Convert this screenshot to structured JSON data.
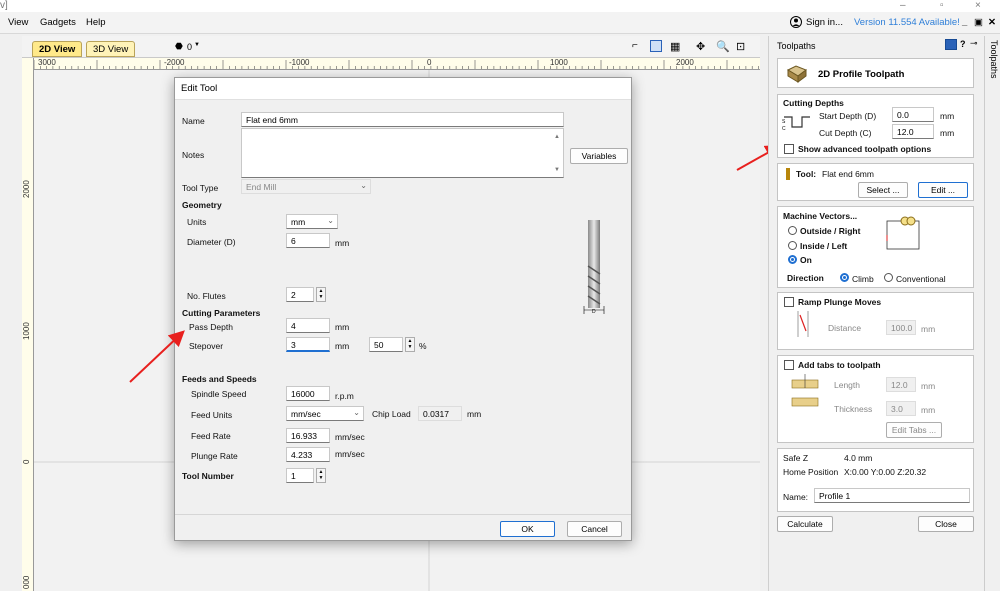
{
  "menubar": {
    "items": [
      "View",
      "Gadgets",
      "Help"
    ],
    "sign_in": "Sign in...",
    "version": "Version 11.554 Available!",
    "win_min": "–",
    "win_restore": "▫",
    "win_close": "×",
    "panel_min": "_",
    "panel_restore": "▣",
    "panel_close": "✕"
  },
  "view_tabs": {
    "tab_2d": "2D View",
    "tab_3d": "3D View",
    "layer_count": "0"
  },
  "ruler": {
    "top_labels": [
      "3000",
      "-2000",
      "-1000",
      "0",
      "1000",
      "2000"
    ],
    "left_labels": [
      "2000",
      "1000",
      "0",
      "000"
    ]
  },
  "dialog": {
    "title": "Edit Tool",
    "name_label": "Name",
    "name_value": "Flat end 6mm",
    "notes_label": "Notes",
    "notes_value": "",
    "variables_button": "Variables",
    "tool_type_label": "Tool Type",
    "tool_type_value": "End Mill",
    "geometry_heading": "Geometry",
    "units_label": "Units",
    "units_value": "mm",
    "diameter_label": "Diameter (D)",
    "diameter_value": "6",
    "diameter_unit": "mm",
    "flutes_label": "No. Flutes",
    "flutes_value": "2",
    "cutting_heading": "Cutting Parameters",
    "pass_depth_label": "Pass Depth",
    "pass_depth_value": "4",
    "pass_depth_unit": "mm",
    "stepover_label": "Stepover",
    "stepover_value": "3",
    "stepover_unit": "mm",
    "stepover_pct_value": "50",
    "stepover_pct_unit": "%",
    "feeds_heading": "Feeds and Speeds",
    "spindle_label": "Spindle Speed",
    "spindle_value": "16000",
    "spindle_unit": "r.p.m",
    "feed_units_label": "Feed Units",
    "feed_units_value": "mm/sec",
    "chip_load_label": "Chip Load",
    "chip_load_value": "0.0317",
    "chip_load_unit": "mm",
    "feed_rate_label": "Feed Rate",
    "feed_rate_value": "16.933",
    "feed_rate_unit": "mm/sec",
    "plunge_label": "Plunge Rate",
    "plunge_value": "4.233",
    "plunge_unit": "mm/sec",
    "tool_number_label": "Tool Number",
    "tool_number_value": "1",
    "ok_button": "OK",
    "cancel_button": "Cancel"
  },
  "panel": {
    "header": "Toolpaths",
    "side_tab": "Toolpaths",
    "title": "2D Profile Toolpath",
    "cutting_depths_heading": "Cutting Depths",
    "start_depth_label": "Start Depth (D)",
    "start_depth_value": "0.0",
    "cut_depth_label": "Cut Depth (C)",
    "cut_depth_value": "12.0",
    "depth_unit": "mm",
    "advanced_label": "Show advanced toolpath options",
    "tool_label": "Tool:",
    "tool_value": "Flat end 6mm",
    "select_button": "Select ...",
    "edit_button": "Edit ...",
    "machine_vectors_heading": "Machine Vectors...",
    "outside_right": "Outside / Right",
    "inside_left": "Inside / Left",
    "on_label": "On",
    "direction_label": "Direction",
    "climb_label": "Climb",
    "conventional_label": "Conventional",
    "ramp_label": "Ramp Plunge Moves",
    "distance_label": "Distance",
    "distance_value": "100.0",
    "distance_unit": "mm",
    "tabs_label": "Add tabs to toolpath",
    "length_label": "Length",
    "length_value": "12.0",
    "thickness_label": "Thickness",
    "thickness_value": "3.0",
    "tabs_unit": "mm",
    "edit_tabs_button": "Edit Tabs ...",
    "safe_z_label": "Safe Z",
    "safe_z_value": "4.0 mm",
    "home_label": "Home Position",
    "home_value": "X:0.00 Y:0.00 Z:20.32",
    "name_label": "Name:",
    "name_value": "Profile 1",
    "calculate_button": "Calculate",
    "close_button": "Close"
  },
  "colors": {
    "annotation_arrow": "#e8201e",
    "accent": "#1f6fd1",
    "tab_2d": "#ffe98a"
  }
}
